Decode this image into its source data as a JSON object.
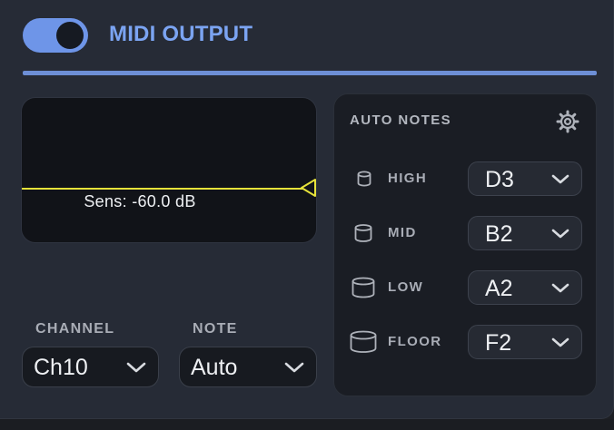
{
  "header": {
    "toggle_on": true,
    "title": "MIDI OUTPUT",
    "accent_color": "#6e95e8"
  },
  "sensitivity": {
    "label": "Sens: -60.0 dB",
    "line_color": "#e6e23a"
  },
  "channel": {
    "label": "CHANNEL",
    "value": "Ch10"
  },
  "note": {
    "label": "NOTE",
    "value": "Auto"
  },
  "auto_notes": {
    "title": "AUTO NOTES",
    "rows": [
      {
        "label": "HIGH",
        "value": "D3",
        "icon": "drum-high-icon"
      },
      {
        "label": "MID",
        "value": "B2",
        "icon": "drum-mid-icon"
      },
      {
        "label": "LOW",
        "value": "A2",
        "icon": "drum-low-icon"
      },
      {
        "label": "FLOOR",
        "value": "F2",
        "icon": "drum-floor-icon"
      }
    ]
  }
}
